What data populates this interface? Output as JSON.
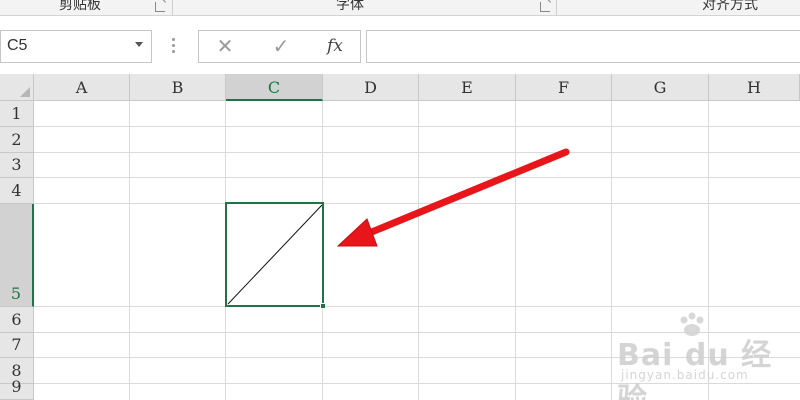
{
  "ribbon": {
    "groups": [
      {
        "label": "剪贴板"
      },
      {
        "label": "字体"
      },
      {
        "label": "对齐方式"
      }
    ]
  },
  "formula_bar": {
    "name_box": "C5",
    "cancel_icon": "✕",
    "enter_icon": "✓",
    "fx_label": "fx",
    "formula_value": ""
  },
  "grid": {
    "columns": [
      "A",
      "B",
      "C",
      "D",
      "E",
      "F",
      "G",
      "H"
    ],
    "rows": [
      "1",
      "2",
      "3",
      "4",
      "5",
      "6",
      "7",
      "8",
      "9"
    ],
    "selected_column": "C",
    "selected_row": "5"
  },
  "annotation": {
    "arrow_color": "#e8161b",
    "selection_color": "#217346"
  },
  "watermark": {
    "main": "Bai du 经验",
    "sub": "jingyan.baidu.com"
  }
}
